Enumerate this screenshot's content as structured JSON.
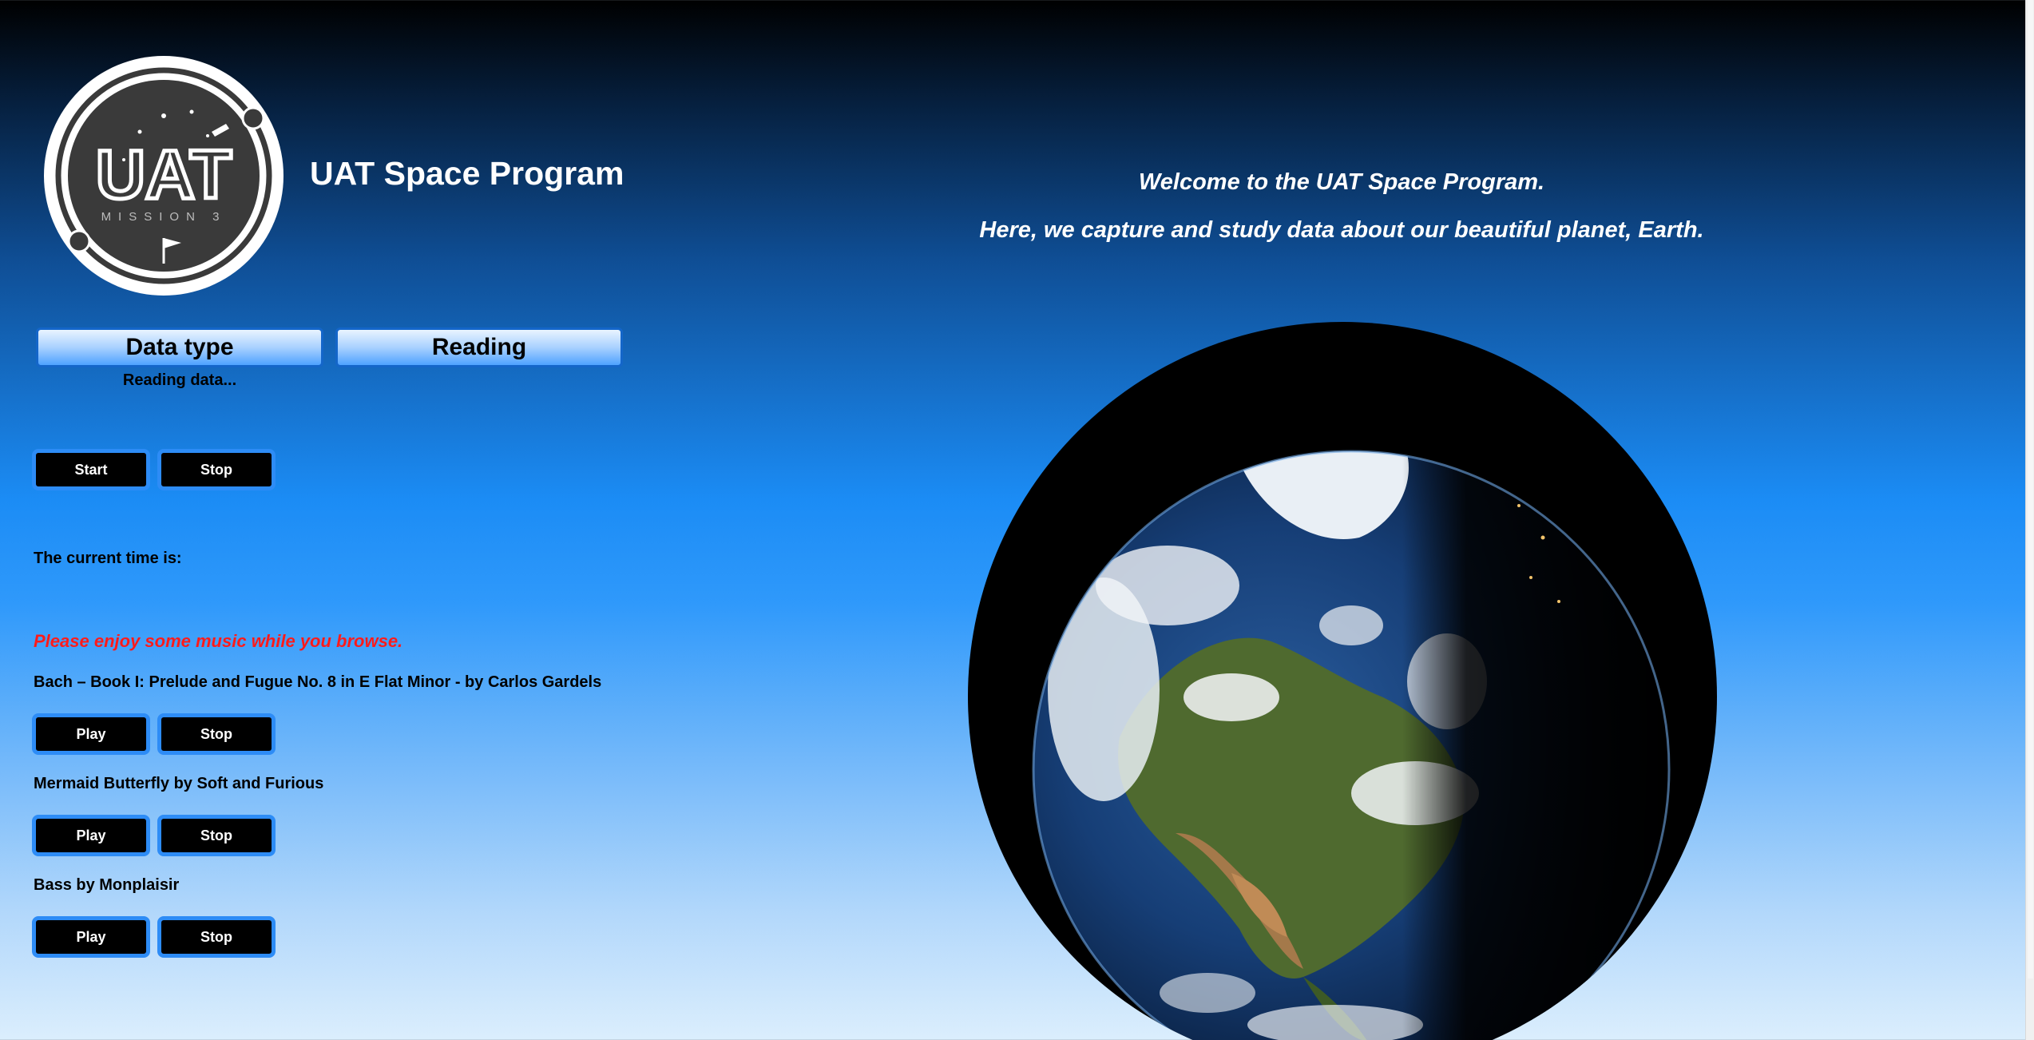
{
  "logo": {
    "letters": "UAT",
    "subtitle": "MISSION 3",
    "icon": "uat-mission-3-logo"
  },
  "header": {
    "title": "UAT Space Program"
  },
  "tabs": [
    {
      "label": "Data type"
    },
    {
      "label": "Reading"
    }
  ],
  "reading": {
    "status": "Reading data..."
  },
  "timer_controls": {
    "start_label": "Start",
    "stop_label": "Stop"
  },
  "clock": {
    "label": "The current time is:"
  },
  "music": {
    "invite": "Please enjoy some music while you browse.",
    "tracks": [
      {
        "title": "Bach – Book I: Prelude and Fugue No. 8 in E Flat Minor - by Carlos Gardels",
        "play_label": "Play",
        "stop_label": "Stop"
      },
      {
        "title": "Mermaid Butterfly by Soft and Furious",
        "play_label": "Play",
        "stop_label": "Stop"
      },
      {
        "title": "Bass by Monplaisir",
        "play_label": "Play",
        "stop_label": "Stop"
      }
    ]
  },
  "welcome": {
    "line1": "Welcome to the UAT Space Program.",
    "line2": "Here, we capture and study data about our beautiful planet, Earth."
  },
  "earth_image": {
    "icon": "earth-globe-image"
  },
  "colors": {
    "button_border": "#2d8cf6",
    "button_bg": "#000000",
    "invite_text": "#ff1b1b",
    "tab_border": "#1466c9"
  }
}
